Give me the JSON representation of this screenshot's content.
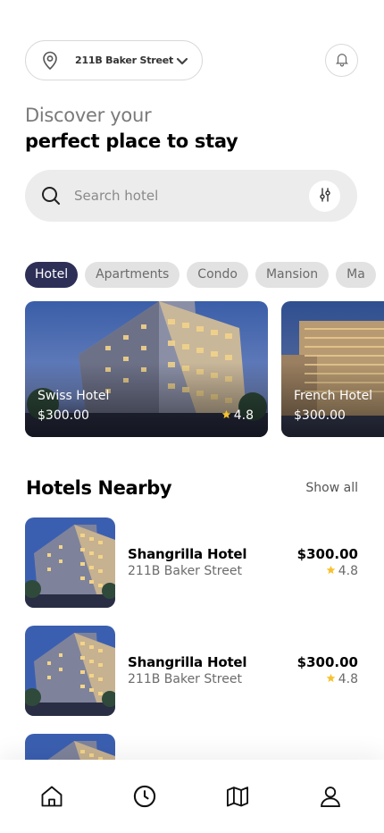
{
  "location": {
    "address": "211B Baker Street",
    "pin_icon": "location-pin-icon",
    "dropdown_icon": "chevron-down-icon"
  },
  "notifications": {
    "icon": "bell-icon"
  },
  "greeting": {
    "line1": "Discover your",
    "line2": "perfect place to stay"
  },
  "search": {
    "placeholder": "Search hotel",
    "icon": "search-icon",
    "filter_icon": "filter-sliders-icon"
  },
  "categories": [
    "Hotel",
    "Apartments",
    "Condo",
    "Mansion",
    "Ma"
  ],
  "selected_category": "Hotel",
  "featured": [
    {
      "name": "Swiss Hotel",
      "price": "$300.00",
      "rating": "4.8"
    },
    {
      "name": "French Hotel",
      "price": "$300.00"
    }
  ],
  "nearby": {
    "title": "Hotels Nearby",
    "show_all": "Show all",
    "items": [
      {
        "name": "Shangrilla Hotel",
        "address": "211B Baker Street",
        "price": "$300.00",
        "rating": "4.8"
      },
      {
        "name": "Shangrilla Hotel",
        "address": "211B Baker Street",
        "price": "$300.00",
        "rating": "4.8"
      }
    ]
  },
  "tabbar": [
    "home-icon",
    "clock-icon",
    "map-icon",
    "user-icon"
  ],
  "colors": {
    "accent": "#2e2f57",
    "star": "#f6c22f",
    "chip_bg": "#e2e2e2",
    "search_bg": "#ececec"
  }
}
